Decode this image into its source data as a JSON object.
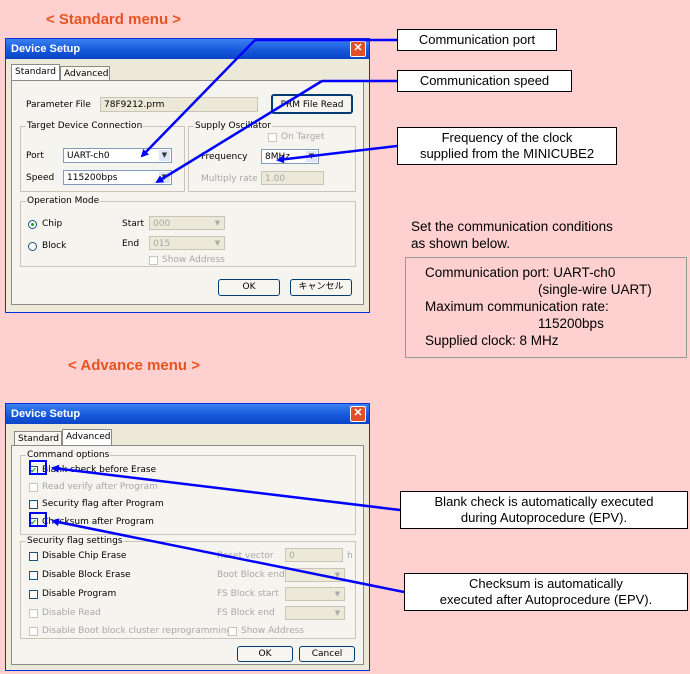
{
  "headings": {
    "standard": "< Standard menu >",
    "advance": "< Advance menu >"
  },
  "callouts": {
    "comm_port": "Communication port",
    "comm_speed": "Communication speed",
    "freq_line1": "Frequency of the clock",
    "freq_line2": "supplied from the MINICUBE2",
    "blank_line1": "Blank check is automatically executed",
    "blank_line2": "during Autoprocedure (EPV).",
    "checksum_line1": "Checksum is automatically",
    "checksum_line2": "executed after Autoprocedure (EPV)."
  },
  "note": {
    "line1": "Set the communication conditions",
    "line2": "as shown below.",
    "cond1": "Communication port:  UART-ch0",
    "cond2": "(single-wire UART)",
    "cond3": "Maximum communication rate:",
    "cond4": "115200bps",
    "cond5": "Supplied clock:  8 MHz"
  },
  "dialog1": {
    "title": "Device Setup",
    "close": "✕",
    "tabs": [
      "Standard",
      "Advanced"
    ],
    "parameter_file_label": "Parameter File",
    "parameter_file_value": "78F9212.prm",
    "prm_button": "PRM File Read",
    "target_group": "Target Device Connection",
    "port_label": "Port",
    "port_value": "UART-ch0",
    "speed_label": "Speed",
    "speed_value": "115200bps",
    "supply_group": "Supply Oscillator",
    "on_target": "On Target",
    "frequency_label": "Frequency",
    "frequency_value": "8MHz",
    "multiply_label": "Multiply rate",
    "multiply_value": "1.00",
    "opmode_group": "Operation Mode",
    "chip": "Chip",
    "block": "Block",
    "start_label": "Start",
    "start_value": "000",
    "end_label": "End",
    "end_value": "015",
    "show_address": "Show Address",
    "ok": "OK",
    "cancel": "キャンセル"
  },
  "dialog2": {
    "title": "Device Setup",
    "close": "✕",
    "tabs": [
      "Standard",
      "Advanced"
    ],
    "command_group": "Command options",
    "blank_check": "Blank check before Erase",
    "read_verify": "Read verify after Program",
    "security_after": "Security flag after Program",
    "checksum_after": "Checksum after Program",
    "security_group": "Security flag settings",
    "disable_chip": "Disable Chip Erase",
    "disable_block": "Disable Block Erase",
    "disable_program": "Disable Program",
    "disable_read": "Disable Read",
    "disable_boot": "Disable Boot block cluster reprogramming",
    "reset_vector": "Reset vector",
    "reset_value": "0",
    "reset_unit": "h",
    "boot_block": "Boot Block end",
    "fs_start": "FS Block start",
    "fs_end": "FS Block end",
    "show_address": "Show Address",
    "ok": "OK",
    "cancel": "Cancel"
  }
}
